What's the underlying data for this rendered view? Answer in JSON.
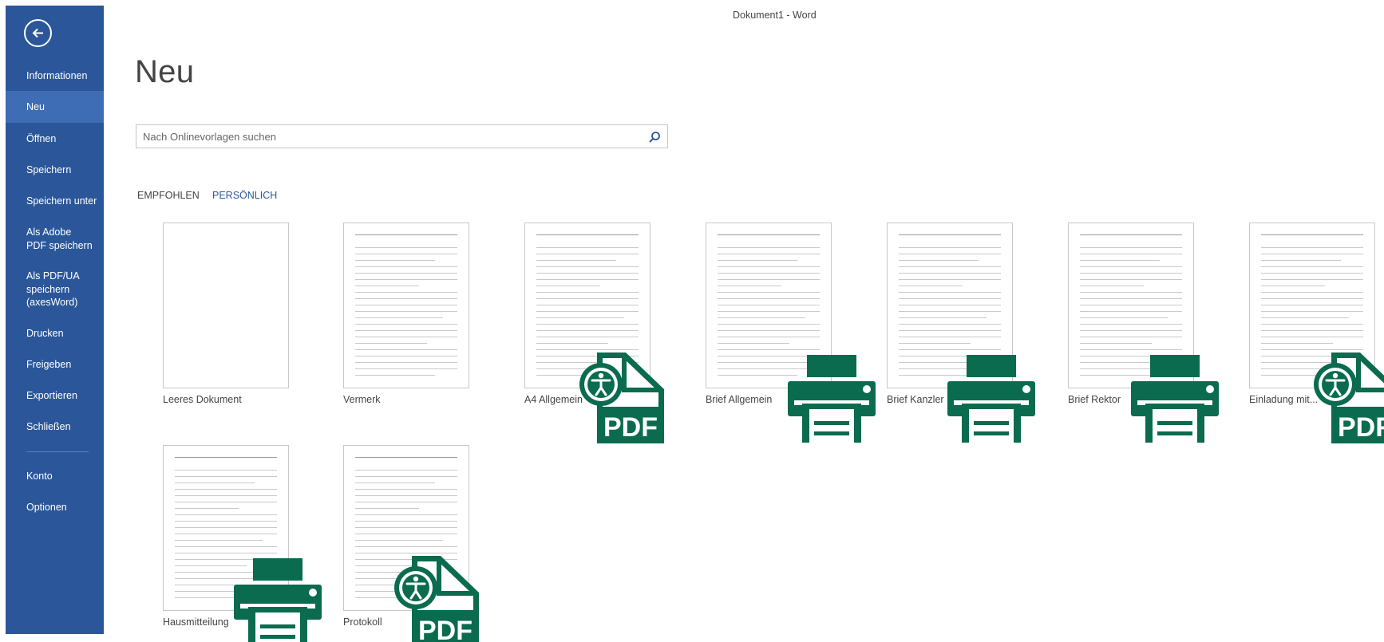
{
  "window": {
    "title": "Dokument1 - Word"
  },
  "sidebar": {
    "back_icon": "back-arrow-icon",
    "items": [
      {
        "label": "Informationen"
      },
      {
        "label": "Neu",
        "selected": true
      },
      {
        "label": "Öffnen"
      },
      {
        "label": "Speichern"
      },
      {
        "label": "Speichern unter"
      },
      {
        "label": "Als Adobe PDF speichern"
      },
      {
        "label": "Als PDF/UA speichern (axesWord)"
      },
      {
        "label": "Drucken"
      },
      {
        "label": "Freigeben"
      },
      {
        "label": "Exportieren"
      },
      {
        "label": "Schließen"
      },
      {
        "label": "Konto"
      },
      {
        "label": "Optionen"
      }
    ],
    "colors": {
      "background": "#2b579a",
      "selected": "#3e6db5"
    }
  },
  "main": {
    "title": "Neu",
    "search": {
      "placeholder": "Nach Onlinevorlagen suchen",
      "value": "",
      "icon": "search-icon"
    },
    "tabs": [
      {
        "label": "EMPFOHLEN"
      },
      {
        "label": "PERSÖNLICH"
      }
    ],
    "templates": [
      {
        "label": "Leeres Dokument",
        "badge": ""
      },
      {
        "label": "Vermerk",
        "badge": ""
      },
      {
        "label": "A4 Allgemein",
        "badge": "pdf-accessibility-icon"
      },
      {
        "label": "Brief Allgemein",
        "badge": "printer-icon"
      },
      {
        "label": "Brief Kanzler",
        "badge": "printer-icon"
      },
      {
        "label": "Brief Rektor",
        "badge": "printer-icon"
      },
      {
        "label": "Einladung mit...",
        "badge": "pdf-accessibility-icon"
      },
      {
        "label": "Hausmitteilung",
        "badge": "printer-icon"
      },
      {
        "label": "Protokoll",
        "badge": "pdf-accessibility-icon"
      }
    ],
    "colors": {
      "badge_green": "#0a6b4f",
      "accent_blue": "#2b579a"
    }
  }
}
